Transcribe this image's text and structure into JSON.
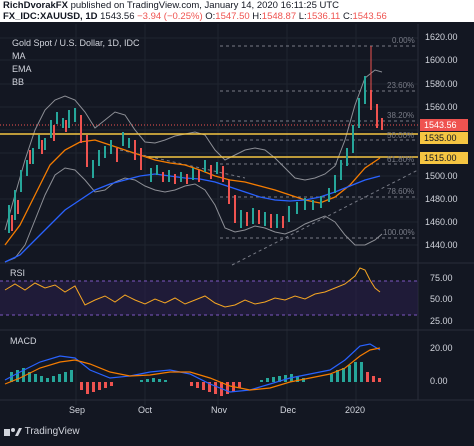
{
  "header": {
    "author": "RichDvorakFX",
    "published_text": "published on TradingView.com, January 14, 2020 16:11:25 UTC",
    "symbol": "FX_IDC:XAUUSD, 1D",
    "last": "1543.56",
    "change": "−3.94 (−0.25%)",
    "open_label": "O:",
    "open": "1547.50",
    "high_label": "H:",
    "high": "1548.87",
    "low_label": "L:",
    "low": "1536.11",
    "close_label": "C:",
    "close": "1543.56"
  },
  "legend": {
    "title": "Gold Spot / U.S. Dollar, 1D, IDC",
    "ma": "MA",
    "ema": "EMA",
    "bb": "BB"
  },
  "fib": [
    "0.00%",
    "23.60%",
    "38.20%",
    "50.00%",
    "61.80%",
    "78.60%",
    "100.00%"
  ],
  "price_scale": [
    "1620.00",
    "1600.00",
    "1580.00",
    "1560.00",
    "1540.00",
    "1520.00",
    "1500.00",
    "1480.00",
    "1460.00",
    "1440.00"
  ],
  "badges": {
    "current": "1543.56",
    "level1": "1535.00",
    "level2": "1515.00"
  },
  "rsi": {
    "label": "RSI",
    "ticks": [
      "75.00",
      "50.00",
      "25.00"
    ]
  },
  "macd": {
    "label": "MACD",
    "ticks": [
      "20.00",
      "0.00"
    ]
  },
  "time_axis": [
    "Sep",
    "Oct",
    "Nov",
    "Dec",
    "2020"
  ],
  "footer": {
    "brand": "TradingView"
  },
  "colors": {
    "background": "#131722",
    "up": "#26a69a",
    "down": "#ef5350",
    "level": "#f5c542",
    "ma": "#f57c00",
    "ema": "#2962ff",
    "bb": "#9e9e9e",
    "rsi_line": "#f5a623",
    "rsi_band": "#7e57c2"
  }
}
